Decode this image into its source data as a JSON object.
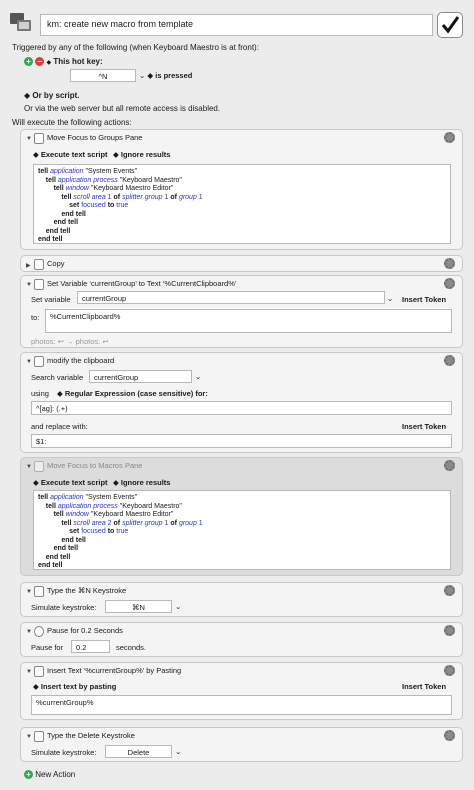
{
  "macro": {
    "name": "km: create new macro from template",
    "trigger_header": "Triggered by any of the following (when Keyboard Maestro is at front):",
    "hotkey_label": "This hot key:",
    "hotkey_value": "^N",
    "hotkey_mode": "is pressed",
    "or_script": "Or by script.",
    "web_server_note": "Or via the web server but all remote access is disabled.",
    "will_execute": "Will execute the following actions:",
    "new_action": "New Action"
  },
  "actions": [
    {
      "title": "Move Focus to Groups Pane",
      "mode1": "Execute text script",
      "mode2": "Ignore results",
      "code": [
        "tell application \"System Events\"",
        "tell application process \"Keyboard Maestro\"",
        "tell window \"Keyboard Maestro Editor\"",
        "tell scroll area 1 of splitter group 1 of group 1",
        "set focused to true",
        "end tell",
        "end tell",
        "end tell",
        "end tell"
      ]
    },
    {
      "title": "Copy"
    },
    {
      "title": "Set Variable ‘currentGroup’ to Text ‘%CurrentClipboard%’",
      "set_label": "Set variable",
      "var_value": "currentGroup",
      "insert_token": "Insert Token",
      "to_label": "to:",
      "to_value": "%CurrentClipboard%",
      "photos": "photos: ↩ → photos: ↩"
    },
    {
      "title": "modify the clipboard",
      "search_label": "Search variable",
      "search_value": "currentGroup",
      "using_label": "using",
      "regex_label": "Regular Expression (case sensitive) for:",
      "regex_value": "^[ag]: (.+)",
      "replace_label": "and replace with:",
      "insert_token": "Insert Token",
      "replace_value": "$1:"
    },
    {
      "title": "Move Focus to Macros Pane",
      "mode1": "Execute text script",
      "mode2": "Ignore results",
      "code": [
        "tell application \"System Events\"",
        "tell application process \"Keyboard Maestro\"",
        "tell window \"Keyboard Maestro Editor\"",
        "tell scroll area 2 of splitter group 1 of group 1",
        "set focused to true",
        "end tell",
        "end tell",
        "end tell",
        "end tell"
      ]
    },
    {
      "title": "Type the ⌘N Keystroke",
      "sim_label": "Simulate keystroke:",
      "sim_value": "⌘N"
    },
    {
      "title": "Pause for 0.2 Seconds",
      "pause_label": "Pause for",
      "pause_value": "0.2",
      "seconds": "seconds."
    },
    {
      "title": "Insert Text ‘%currentGroup%’ by Pasting",
      "mode": "Insert text by pasting",
      "insert_token": "Insert Token",
      "text_value": "%currentGroup%"
    },
    {
      "title": "Type the Delete Keystroke",
      "sim_label": "Simulate keystroke:",
      "sim_value": "Delete"
    }
  ]
}
